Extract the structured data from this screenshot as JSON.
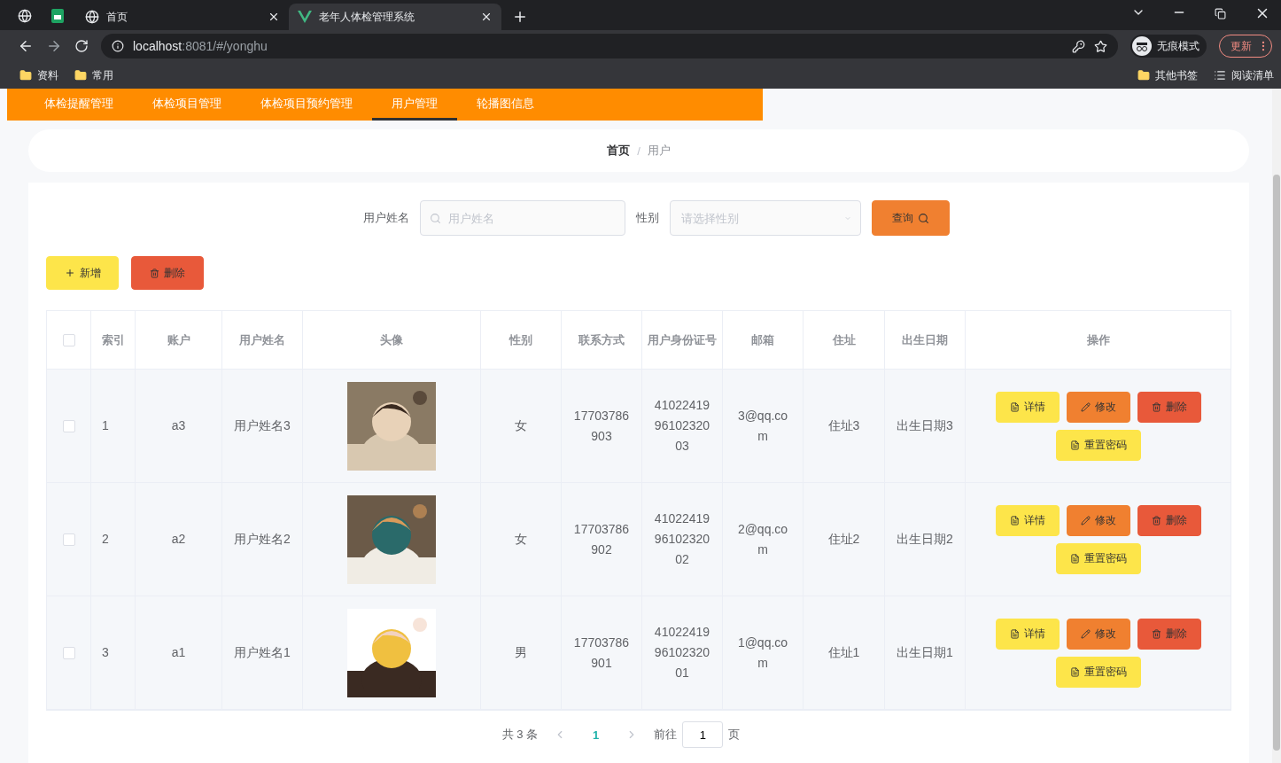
{
  "browser": {
    "tabs": [
      {
        "title": "首页",
        "kind": "globe",
        "selected": false
      },
      {
        "title": "老年人体检管理系统",
        "kind": "vue",
        "selected": true
      }
    ],
    "url_host": "localhost",
    "url_rest": ":8081/#/yonghu",
    "incognito": "无痕模式",
    "update": "更新",
    "bookmarks": [
      "资料",
      "常用"
    ],
    "other_bookmarks": "其他书签",
    "reading_list": "阅读清单"
  },
  "nav": [
    {
      "label": "体检提醒管理",
      "selected": false
    },
    {
      "label": "体检项目管理",
      "selected": false
    },
    {
      "label": "体检项目预约管理",
      "selected": false
    },
    {
      "label": "用户管理",
      "selected": true
    },
    {
      "label": "轮播图信息",
      "selected": false
    }
  ],
  "breadcrumb": {
    "home": "首页",
    "separator": "/",
    "current": "用户"
  },
  "search": {
    "name_label": "用户姓名",
    "name_placeholder": "用户姓名",
    "gender_label": "性别",
    "gender_placeholder": "请选择性别",
    "query": "查询"
  },
  "actions": {
    "add": "新增",
    "delete": "删除"
  },
  "table": {
    "select_all": false,
    "columns": [
      "索引",
      "账户",
      "用户姓名",
      "头像",
      "性别",
      "联系方式",
      "用户身份证号",
      "邮箱",
      "住址",
      "出生日期",
      "操作"
    ],
    "rows": [
      {
        "checked": false,
        "index": "1",
        "account": "a3",
        "name": "用户姓名3",
        "gender": "女",
        "phone": "17703786903",
        "id_card": "410224199610232003",
        "email": "3@qq.com",
        "address": "住址3",
        "birth": "出生日期3",
        "buttons": {
          "detail": "详情",
          "edit": "修改",
          "delete": "删除",
          "reset": "重置密码"
        }
      },
      {
        "checked": false,
        "index": "2",
        "account": "a2",
        "name": "用户姓名2",
        "gender": "女",
        "phone": "17703786902",
        "id_card": "410224199610232002",
        "email": "2@qq.com",
        "address": "住址2",
        "birth": "出生日期2",
        "buttons": {
          "detail": "详情",
          "edit": "修改",
          "delete": "删除",
          "reset": "重置密码"
        }
      },
      {
        "checked": false,
        "index": "3",
        "account": "a1",
        "name": "用户姓名1",
        "gender": "男",
        "phone": "17703786901",
        "id_card": "410224199610232001",
        "email": "1@qq.com",
        "address": "住址1",
        "birth": "出生日期1",
        "buttons": {
          "detail": "详情",
          "edit": "修改",
          "delete": "删除",
          "reset": "重置密码"
        }
      }
    ]
  },
  "pagination": {
    "total": "共 3 条",
    "pages": [
      {
        "label": "1",
        "selected": true
      }
    ],
    "goto": "前往",
    "page_value": "1",
    "page_suffix": "页"
  }
}
